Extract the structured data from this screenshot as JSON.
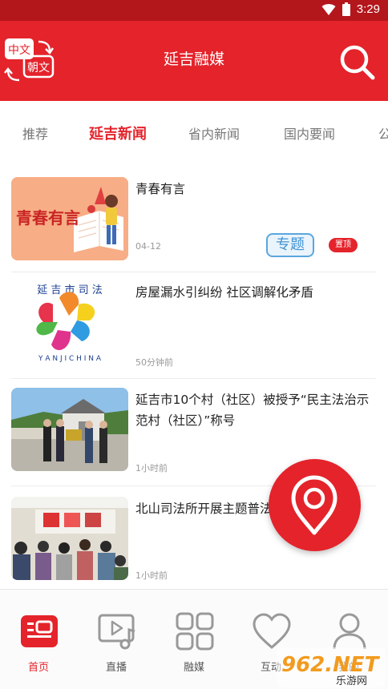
{
  "status_bar": {
    "time": "3:29"
  },
  "header": {
    "title": "延吉融媒",
    "lang_top": "中文",
    "lang_bottom": "朝文"
  },
  "tabs": [
    {
      "label": "推荐"
    },
    {
      "label": "延吉新闻"
    },
    {
      "label": "省内新闻"
    },
    {
      "label": "国内要闻"
    },
    {
      "label": "公"
    }
  ],
  "news": [
    {
      "title": "青春有言",
      "time": "04-12",
      "badge_topic": "专题",
      "badge_top": "置顶",
      "thumb_text": "青春有言"
    },
    {
      "title": "房屋漏水引纠纷 社区调解化矛盾",
      "time": "50分钟前",
      "thumb_text_top": "延 吉 市 司 法",
      "thumb_text_bottom": "Y A N J I   C H I N A"
    },
    {
      "title": "延吉市10个村（社区）被授予“民主法治示范村（社区）”称号",
      "time": "1小时前"
    },
    {
      "title": "北山司法所开展主题普法",
      "time": "1小时前"
    }
  ],
  "bottom_nav": [
    {
      "label": "首页"
    },
    {
      "label": "直播"
    },
    {
      "label": "融媒"
    },
    {
      "label": "互动"
    },
    {
      "label": "我的"
    }
  ],
  "watermark": {
    "main": "962.NET",
    "sub": "乐游网"
  },
  "colors": {
    "brand_red": "#e4232b",
    "status_red": "#b3161b",
    "topic_blue": "#3f93d3"
  }
}
